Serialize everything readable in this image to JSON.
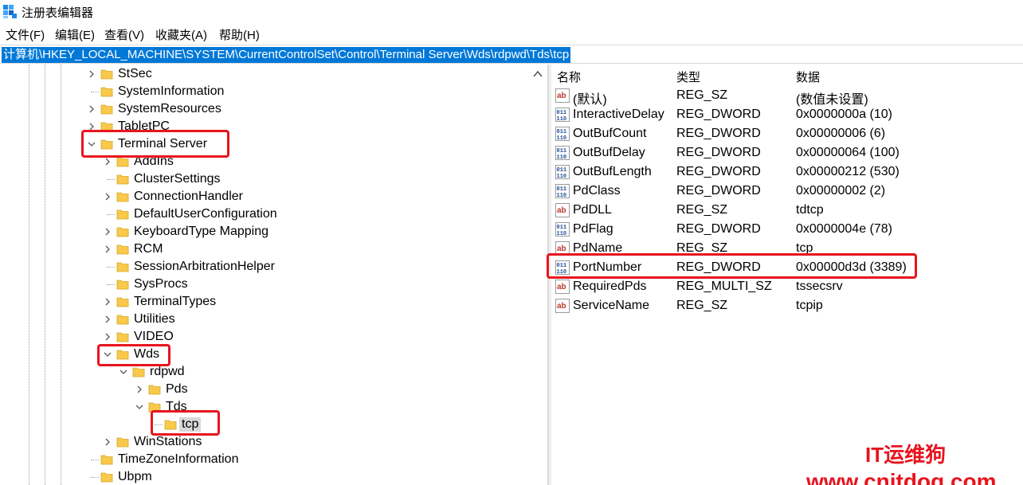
{
  "window": {
    "title": "注册表编辑器"
  },
  "menu": [
    {
      "label": "文件(F)"
    },
    {
      "label": "编辑(E)"
    },
    {
      "label": "查看(V)"
    },
    {
      "label": "收藏夹(A)"
    },
    {
      "label": "帮助(H)"
    }
  ],
  "address": {
    "path": "计算机\\HKEY_LOCAL_MACHINE\\SYSTEM\\CurrentControlSet\\Control\\Terminal Server\\Wds\\rdpwd\\Tds\\tcp"
  },
  "tree": {
    "nodes": [
      {
        "label": "StSec",
        "expander": "collapsed"
      },
      {
        "label": "SystemInformation",
        "expander": "none"
      },
      {
        "label": "SystemResources",
        "expander": "collapsed"
      },
      {
        "label": "TabletPC",
        "expander": "collapsed"
      },
      {
        "label": "Terminal Server",
        "expander": "expanded"
      },
      {
        "label": "AddIns",
        "expander": "collapsed"
      },
      {
        "label": "ClusterSettings",
        "expander": "none"
      },
      {
        "label": "ConnectionHandler",
        "expander": "collapsed"
      },
      {
        "label": "DefaultUserConfiguration",
        "expander": "none"
      },
      {
        "label": "KeyboardType Mapping",
        "expander": "collapsed"
      },
      {
        "label": "RCM",
        "expander": "collapsed"
      },
      {
        "label": "SessionArbitrationHelper",
        "expander": "none"
      },
      {
        "label": "SysProcs",
        "expander": "none"
      },
      {
        "label": "TerminalTypes",
        "expander": "collapsed"
      },
      {
        "label": "Utilities",
        "expander": "collapsed"
      },
      {
        "label": "VIDEO",
        "expander": "collapsed"
      },
      {
        "label": "Wds",
        "expander": "expanded"
      },
      {
        "label": "rdpwd",
        "expander": "expanded"
      },
      {
        "label": "Pds",
        "expander": "collapsed"
      },
      {
        "label": "Tds",
        "expander": "expanded"
      },
      {
        "label": "tcp",
        "expander": "none",
        "selected": true
      },
      {
        "label": "WinStations",
        "expander": "collapsed"
      },
      {
        "label": "TimeZoneInformation",
        "expander": "none"
      },
      {
        "label": "Ubpm",
        "expander": "none"
      }
    ]
  },
  "values": {
    "columns": {
      "name": "名称",
      "type": "类型",
      "data": "数据"
    },
    "rows": [
      {
        "icon": "string-value-icon",
        "name": "(默认)",
        "type": "REG_SZ",
        "data": "(数值未设置)"
      },
      {
        "icon": "binary-value-icon",
        "name": "InteractiveDelay",
        "type": "REG_DWORD",
        "data": "0x0000000a (10)"
      },
      {
        "icon": "binary-value-icon",
        "name": "OutBufCount",
        "type": "REG_DWORD",
        "data": "0x00000006 (6)"
      },
      {
        "icon": "binary-value-icon",
        "name": "OutBufDelay",
        "type": "REG_DWORD",
        "data": "0x00000064 (100)"
      },
      {
        "icon": "binary-value-icon",
        "name": "OutBufLength",
        "type": "REG_DWORD",
        "data": "0x00000212 (530)"
      },
      {
        "icon": "binary-value-icon",
        "name": "PdClass",
        "type": "REG_DWORD",
        "data": "0x00000002 (2)"
      },
      {
        "icon": "string-value-icon",
        "name": "PdDLL",
        "type": "REG_SZ",
        "data": "tdtcp"
      },
      {
        "icon": "binary-value-icon",
        "name": "PdFlag",
        "type": "REG_DWORD",
        "data": "0x0000004e (78)"
      },
      {
        "icon": "string-value-icon",
        "name": "PdName",
        "type": "REG_SZ",
        "data": "tcp"
      },
      {
        "icon": "binary-value-icon",
        "name": "PortNumber",
        "type": "REG_DWORD",
        "data": "0x00000d3d (3389)"
      },
      {
        "icon": "string-value-icon",
        "name": "RequiredPds",
        "type": "REG_MULTI_SZ",
        "data": "tssecsrv"
      },
      {
        "icon": "string-value-icon",
        "name": "ServiceName",
        "type": "REG_SZ",
        "data": "tcpip"
      }
    ]
  },
  "watermark": {
    "line1": "IT运维狗",
    "line2": "www.cnitdog.com"
  },
  "colors": {
    "highlight": "#0078d7",
    "annotation_red": "#e8141e",
    "folder_yellow": "#f8c94a"
  }
}
